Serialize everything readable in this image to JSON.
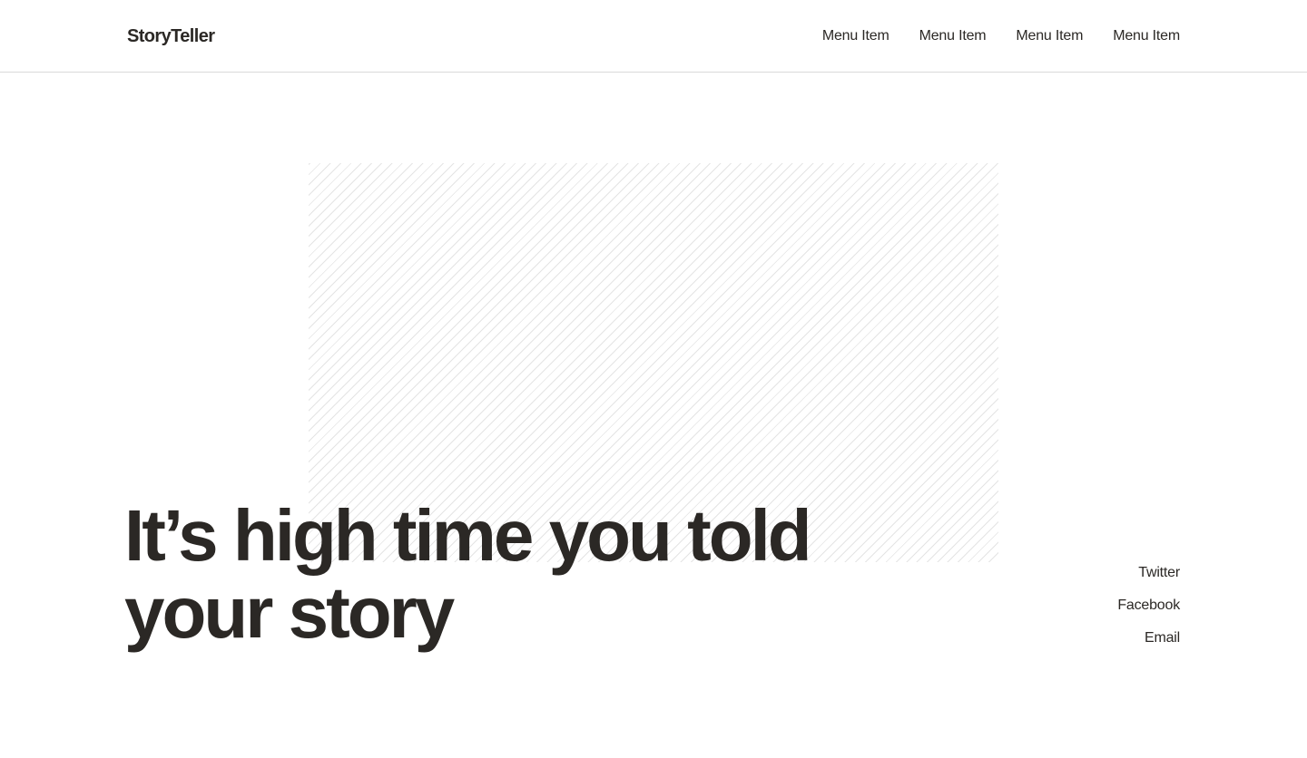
{
  "header": {
    "logo": "StoryTeller",
    "nav": [
      {
        "label": "Menu Item"
      },
      {
        "label": "Menu Item"
      },
      {
        "label": "Menu Item"
      },
      {
        "label": "Menu Item"
      }
    ]
  },
  "hero": {
    "headline": "It’s high time you told your story",
    "image_placeholder": "hatched-image-placeholder"
  },
  "social": {
    "links": [
      {
        "label": "Twitter"
      },
      {
        "label": "Facebook"
      },
      {
        "label": "Email"
      }
    ]
  },
  "colors": {
    "text": "#2b2825",
    "background": "#ffffff",
    "divider": "#d9d9d9",
    "hatch": "#e4e4e4"
  }
}
